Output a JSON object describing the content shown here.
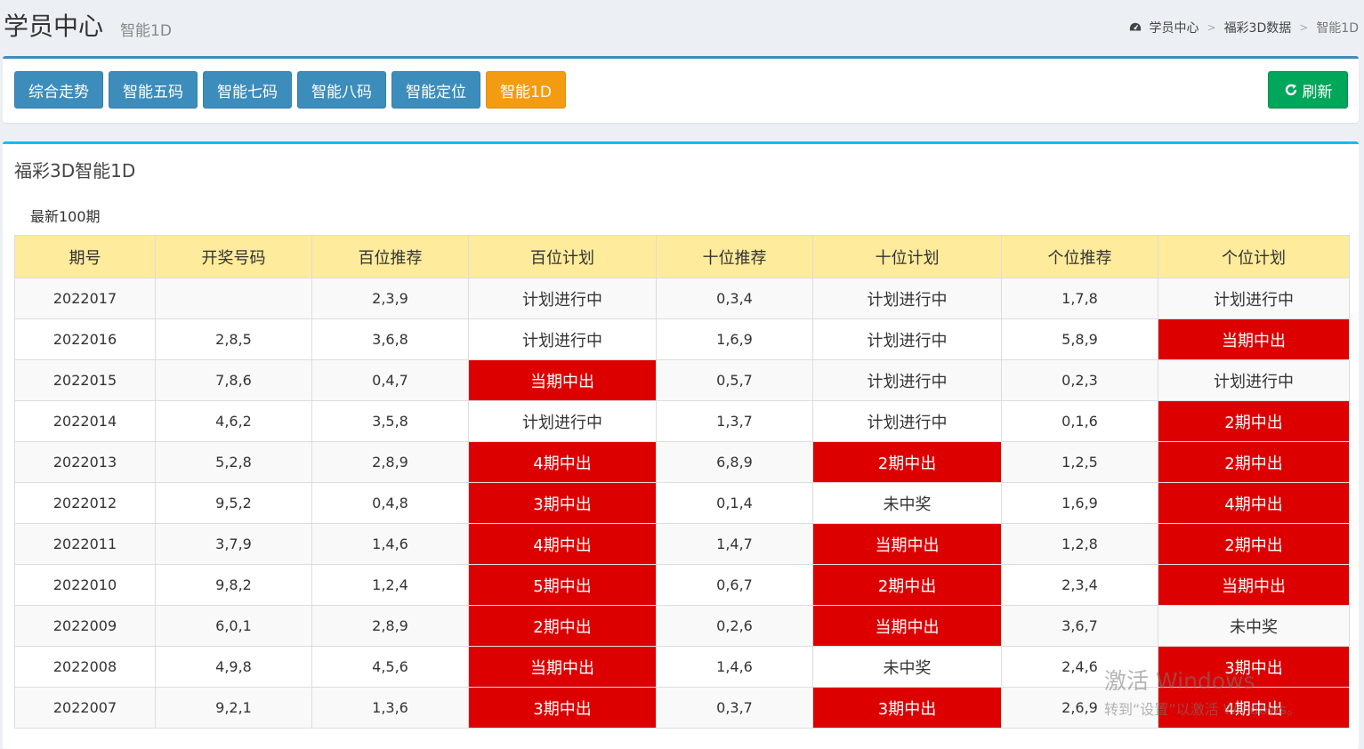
{
  "header": {
    "title": "学员中心",
    "subtitle": "智能1D",
    "breadcrumb": [
      "学员中心",
      "福彩3D数据",
      "智能1D"
    ]
  },
  "toolbar": {
    "buttons": [
      "综合走势",
      "智能五码",
      "智能七码",
      "智能八码",
      "智能定位",
      "智能1D"
    ],
    "active_index": 5,
    "refresh_label": "刷新"
  },
  "panel": {
    "title": "福彩3D智能1D",
    "subtitle": "最新100期"
  },
  "table": {
    "columns": [
      "期号",
      "开奖号码",
      "百位推荐",
      "百位计划",
      "十位推荐",
      "十位计划",
      "个位推荐",
      "个位计划"
    ],
    "rows": [
      [
        "2022017",
        "",
        "2,3,9",
        "计划进行中",
        "0,3,4",
        "计划进行中",
        "1,7,8",
        "计划进行中"
      ],
      [
        "2022016",
        "2,8,5",
        "3,6,8",
        "计划进行中",
        "1,6,9",
        "计划进行中",
        "5,8,9",
        "当期中出"
      ],
      [
        "2022015",
        "7,8,6",
        "0,4,7",
        "当期中出",
        "0,5,7",
        "计划进行中",
        "0,2,3",
        "计划进行中"
      ],
      [
        "2022014",
        "4,6,2",
        "3,5,8",
        "计划进行中",
        "1,3,7",
        "计划进行中",
        "0,1,6",
        "2期中出"
      ],
      [
        "2022013",
        "5,2,8",
        "2,8,9",
        "4期中出",
        "6,8,9",
        "2期中出",
        "1,2,5",
        "2期中出"
      ],
      [
        "2022012",
        "9,5,2",
        "0,4,8",
        "3期中出",
        "0,1,4",
        "未中奖",
        "1,6,9",
        "4期中出"
      ],
      [
        "2022011",
        "3,7,9",
        "1,4,6",
        "4期中出",
        "1,4,7",
        "当期中出",
        "1,2,8",
        "2期中出"
      ],
      [
        "2022010",
        "9,8,2",
        "1,2,4",
        "5期中出",
        "0,6,7",
        "2期中出",
        "2,3,4",
        "当期中出"
      ],
      [
        "2022009",
        "6,0,1",
        "2,8,9",
        "2期中出",
        "0,2,6",
        "当期中出",
        "3,6,7",
        "未中奖"
      ],
      [
        "2022008",
        "4,9,8",
        "4,5,6",
        "当期中出",
        "1,4,6",
        "未中奖",
        "2,4,6",
        "3期中出"
      ],
      [
        "2022007",
        "9,2,1",
        "1,3,6",
        "3期中出",
        "0,3,7",
        "3期中出",
        "2,6,9",
        "4期中出"
      ]
    ]
  },
  "watermark": {
    "line1": "激活 Windows",
    "line2": "转到“设置”以激活 Windows。"
  },
  "colors": {
    "primary": "#3c8dbc",
    "active": "#f39c12",
    "success": "#00a65a",
    "hit": "#dd0000",
    "table_header": "#ffeb9c"
  }
}
